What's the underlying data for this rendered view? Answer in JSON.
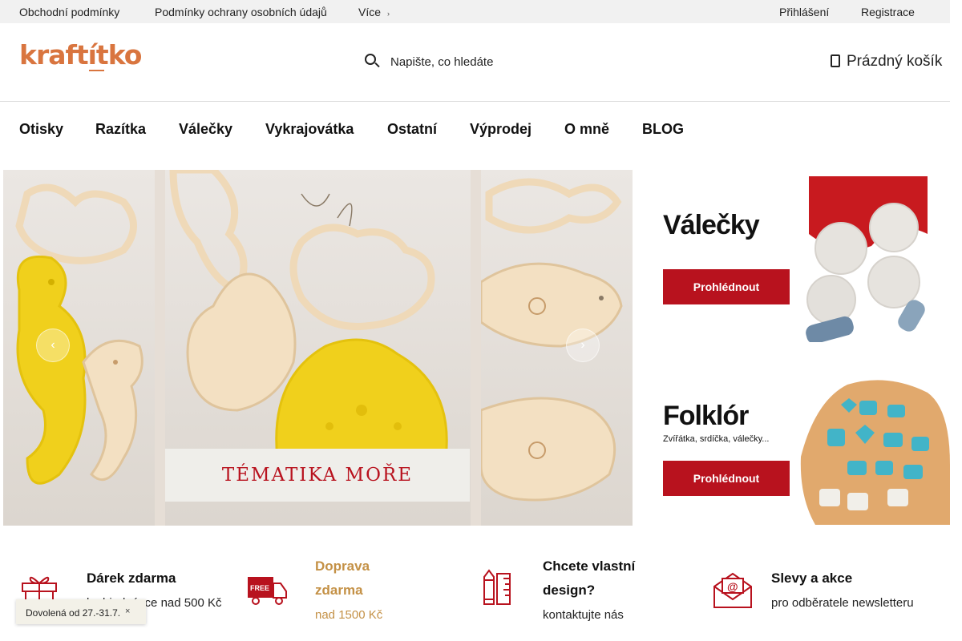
{
  "topbar": {
    "links": [
      "Obchodní podmínky",
      "Podmínky ochrany osobních údajů",
      "Více"
    ],
    "more_chevron": "›",
    "login": "Přihlášení",
    "register": "Registrace"
  },
  "header": {
    "logo": "kraftítko",
    "search_placeholder": "Napište, co hledáte",
    "search_icon": "search-icon",
    "cart_label": "Prázdný košík",
    "cart_icon": "cart-icon"
  },
  "nav": {
    "items": [
      "Otisky",
      "Razítka",
      "Válečky",
      "Vykrajovátka",
      "Ostatní",
      "Výprodej",
      "O mně",
      "BLOG"
    ]
  },
  "hero": {
    "caption": "TÉMATIKA MOŘE",
    "prev_arrow": "‹",
    "next_arrow": "›"
  },
  "promos": [
    {
      "title": "Válečky",
      "subtitle": "",
      "button": "Prohlédnout"
    },
    {
      "title": "Folklór",
      "subtitle": "Zvířátka, srdíčka, válečky...",
      "button": "Prohlédnout"
    }
  ],
  "features": [
    {
      "icon": "gift-icon",
      "title": "Dárek zdarma",
      "subtitle": "k objednávce nad 500 Kč"
    },
    {
      "icon": "truck-free-icon",
      "title": "Doprava zdarma",
      "subtitle": "nad 1500 Kč"
    },
    {
      "icon": "pencil-ruler-icon",
      "title": "Chcete vlastní design?",
      "subtitle": "kontaktujte nás"
    },
    {
      "icon": "mail-envelope-icon",
      "title": "Slevy a akce",
      "subtitle": "pro odběratele newsletteru"
    }
  ],
  "notice": {
    "text": "Dovolená od 27.-31.7.",
    "close": "×"
  },
  "colors": {
    "accent": "#b8121e",
    "logo_orange": "#d9753f",
    "shipping_gold": "#c49146",
    "cookie_yellow": "#f2d51e",
    "cookie_beige": "#eed8b8"
  }
}
